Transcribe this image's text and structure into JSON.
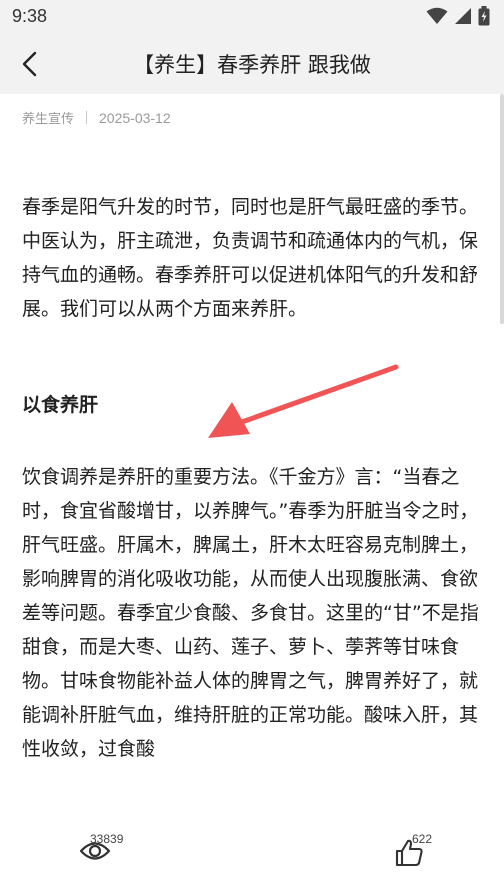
{
  "status_bar": {
    "time": "9:38"
  },
  "header": {
    "title": "【养生】春季养肝 跟我做"
  },
  "meta": {
    "source": "养生宣传",
    "date": "2025-03-12"
  },
  "article": {
    "paragraph_1": "春季是阳气升发的时节，同时也是肝气最旺盛的季节。中医认为，肝主疏泄，负责调节和疏通体内的气机，保持气血的通畅。春季养肝可以促进机体阳气的升发和舒展。我们可以从两个方面来养肝。",
    "heading_1": "以食养肝",
    "paragraph_2": "饮食调养是养肝的重要方法。《千金方》言：“当春之时，食宜省酸增甘，以养脾气。”春季为肝脏当令之时，肝气旺盛。肝属木，脾属土，肝木太旺容易克制脾土，影响脾胃的消化吸收功能，从而使人出现腹胀满、食欲差等问题。春季宜少食酸、多食甘。这里的“甘”不是指甜食，而是大枣、山药、莲子、萝卜、荸荠等甘味食物。甘味食物能补益人体的脾胃之气，脾胃养好了，就能调补肝脏气血，维持肝脏的正常功能。酸味入肝，其性收敛，过食酸"
  },
  "bottom_bar": {
    "views": "33839",
    "likes": "622"
  },
  "colors": {
    "arrow": "#f05454",
    "header_bg": "#f2f2f2"
  }
}
